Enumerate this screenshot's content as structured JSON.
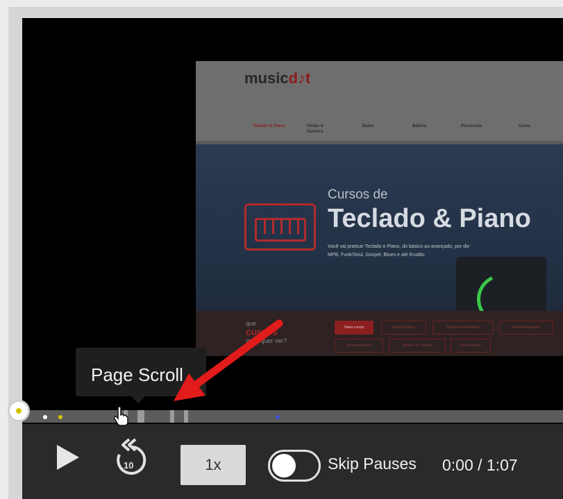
{
  "site": {
    "logo_text": "music",
    "logo_mark": "d",
    "logo_tail": "t",
    "nav": [
      "Teclado & Piano",
      "Violão & Guitarra",
      "Baixo",
      "Bateria",
      "Percussão",
      "Canto"
    ],
    "hero_small": "Cursos de",
    "hero_big": "Teclado & Piano",
    "hero_desc_line1": "Você vai praticar Teclado e Piano, do básico ao avançado, por div",
    "hero_desc_line2": "MPB, Funk/Soul, Gospel, Blues e até Erudito",
    "courses_q1": "que",
    "courses_q2": "cursos",
    "courses_q3": "você quer ver?",
    "chips_row1": [
      "Todos cursos",
      "Teclado Básico",
      "Teclado Intermediário",
      "Teclado Avançado"
    ],
    "chips_row2": [
      "Acompanhando",
      "Timbres no Teclado",
      "Piano Erudito"
    ]
  },
  "tooltip": {
    "label": "Page Scroll"
  },
  "controls": {
    "play_icon": "play-icon",
    "rewind_icon": "rewind-10-icon",
    "rewind_seconds": "10",
    "speed_label": "1x",
    "skip_pauses_label": "Skip Pauses",
    "skip_pauses_on": false,
    "time_display": "0:00 / 1:07"
  },
  "timeline": {
    "position": 0.0,
    "event_marker_colors": [
      "#d4c200",
      "#ffffff",
      "#3a4fd0"
    ]
  },
  "colors": {
    "accent_green": "#3bc94a",
    "arrow_red": "#e21b1b",
    "brand_red": "#8c2020"
  }
}
